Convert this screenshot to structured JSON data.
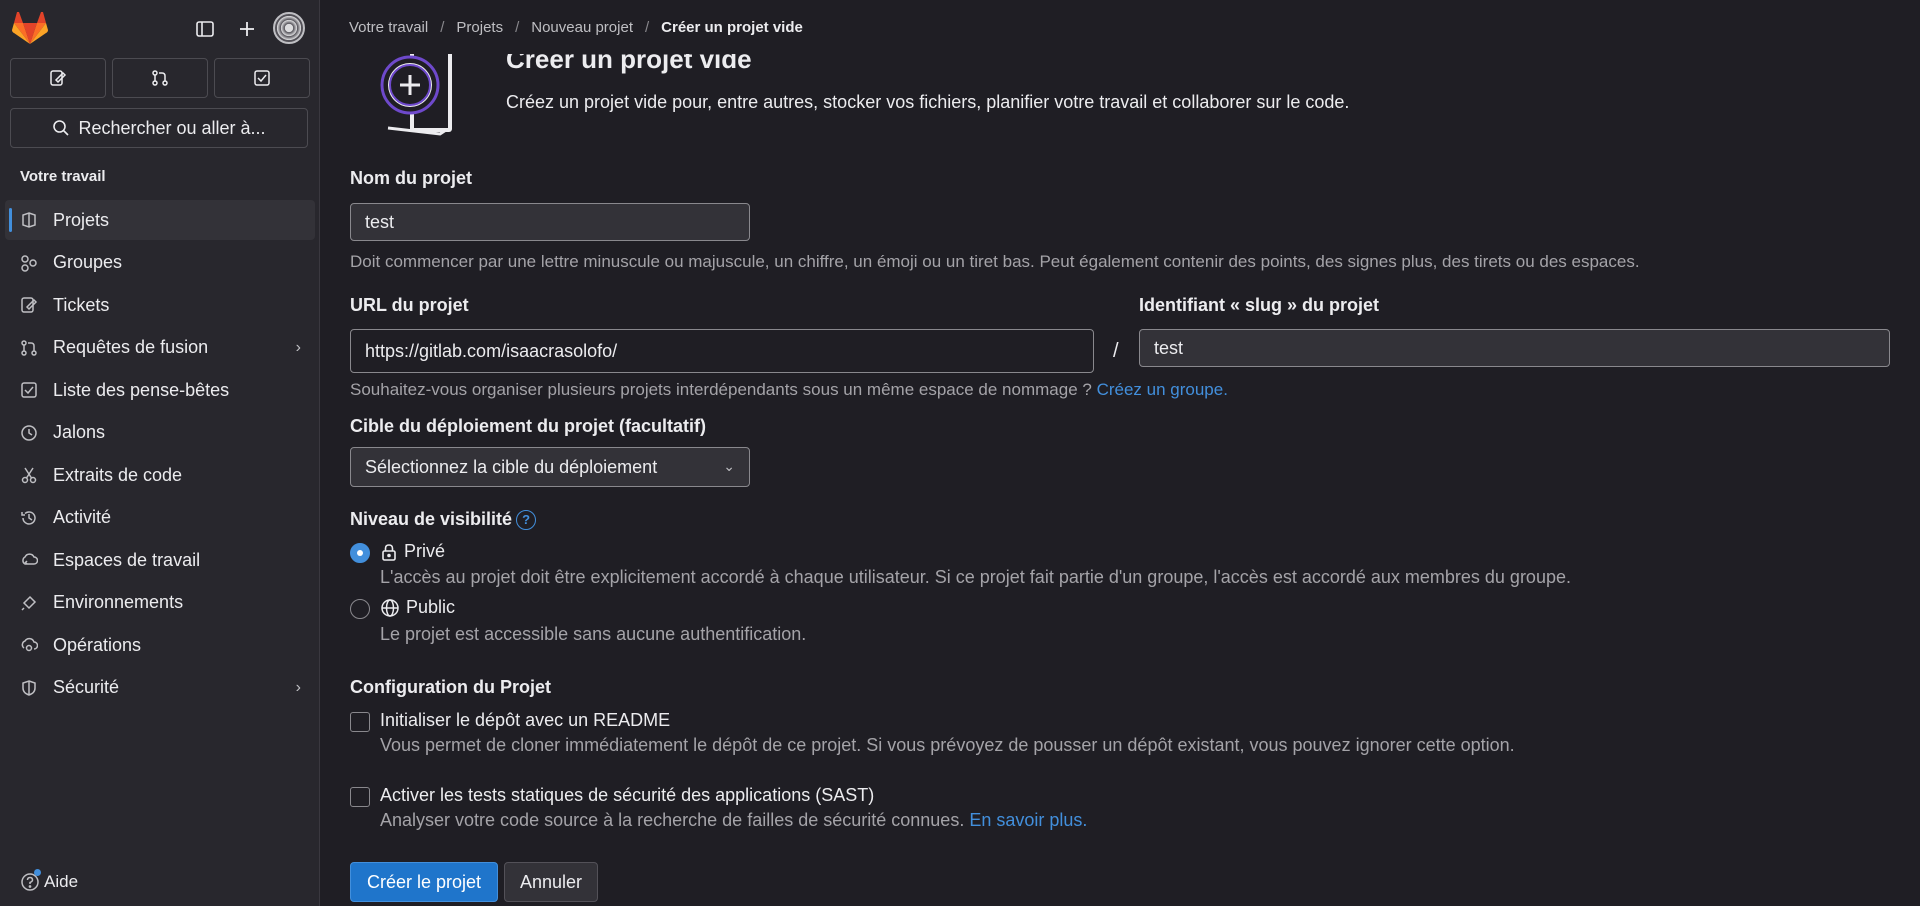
{
  "sidebar": {
    "search_label": "Rechercher ou aller à...",
    "section_title": "Votre travail",
    "items": [
      {
        "label": "Projets",
        "icon": "project-icon"
      },
      {
        "label": "Groupes",
        "icon": "group-icon"
      },
      {
        "label": "Tickets",
        "icon": "issues-icon"
      },
      {
        "label": "Requêtes de fusion",
        "icon": "merge-request-icon"
      },
      {
        "label": "Liste des pense-bêtes",
        "icon": "todo-icon"
      },
      {
        "label": "Jalons",
        "icon": "milestone-icon"
      },
      {
        "label": "Extraits de code",
        "icon": "snippet-icon"
      },
      {
        "label": "Activité",
        "icon": "activity-icon"
      },
      {
        "label": "Espaces de travail",
        "icon": "workspace-icon"
      },
      {
        "label": "Environnements",
        "icon": "environment-icon"
      },
      {
        "label": "Opérations",
        "icon": "operations-icon"
      },
      {
        "label": "Sécurité",
        "icon": "security-icon"
      }
    ],
    "help_label": "Aide"
  },
  "breadcrumb": {
    "items": [
      "Votre travail",
      "Projets",
      "Nouveau projet"
    ],
    "current": "Créer un projet vide"
  },
  "page": {
    "heading": "Créer un projet vide",
    "description": "Créez un projet vide pour, entre autres, stocker vos fichiers, planifier votre travail et collaborer sur le code."
  },
  "form": {
    "name_label": "Nom du projet",
    "name_value": "test",
    "name_help": "Doit commencer par une lettre minuscule ou majuscule, un chiffre, un émoji ou un tiret bas. Peut également contenir des points, des signes plus, des tirets ou des espaces.",
    "url_label": "URL du projet",
    "url_value": "https://gitlab.com/isaacrasolofo/",
    "slash": "/",
    "slug_label": "Identifiant « slug » du projet",
    "slug_value": "test",
    "namespace_help": "Souhaitez-vous organiser plusieurs projets interdépendants sous un même espace de nommage ?",
    "namespace_link": "Créez un groupe.",
    "deploy_label": "Cible du déploiement du projet (facultatif)",
    "deploy_value": "Sélectionnez la cible du déploiement",
    "visibility_label": "Niveau de visibilité",
    "visibility_help_icon": "?",
    "visibility_options": [
      {
        "label": "Privé",
        "description": "L'accès au projet doit être explicitement accordé à chaque utilisateur. Si ce projet fait partie d'un groupe, l'accès est accordé aux membres du groupe.",
        "checked": true
      },
      {
        "label": "Public",
        "description": "Le projet est accessible sans aucune authentification.",
        "checked": false
      }
    ],
    "config_label": "Configuration du Projet",
    "config_options": [
      {
        "label": "Initialiser le dépôt avec un README",
        "description": "Vous permet de cloner immédiatement le dépôt de ce projet. Si vous prévoyez de pousser un dépôt existant, vous pouvez ignorer cette option.",
        "checked": false
      },
      {
        "label": "Activer les tests statiques de sécurité des applications (SAST)",
        "description": "Analyser votre code source à la recherche de failles de sécurité connues.",
        "link": "En savoir plus.",
        "checked": false
      }
    ],
    "submit_label": "Créer le projet",
    "cancel_label": "Annuler"
  },
  "colors": {
    "accent": "#428fdc",
    "primary_button": "#1f75cb",
    "background": "#1f1e24",
    "sidebar": "#28272d"
  }
}
